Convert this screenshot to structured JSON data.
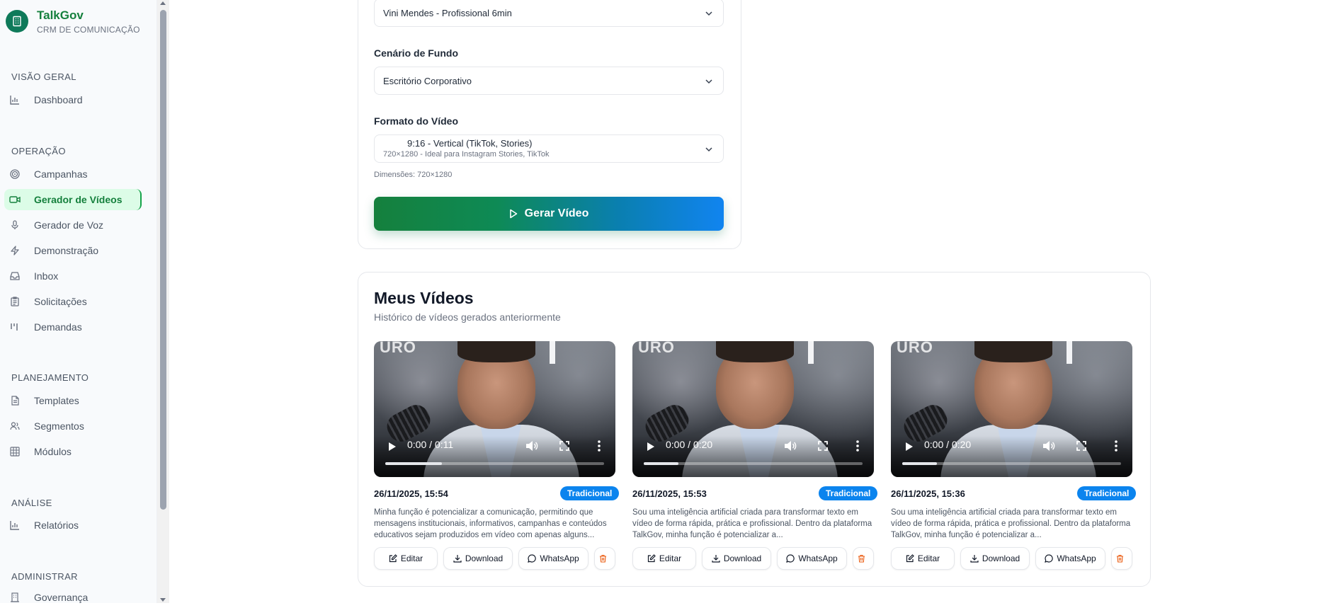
{
  "brand": {
    "title": "TalkGov",
    "subtitle": "CRM DE COMUNICAÇÃO",
    "logo_icon": "building-icon",
    "color": "#15803d"
  },
  "sidebar": {
    "sections": [
      {
        "title": "VISÃO GERAL",
        "items": [
          {
            "label": "Dashboard",
            "icon": "bar-chart-icon"
          }
        ]
      },
      {
        "title": "OPERAÇÃO",
        "items": [
          {
            "label": "Campanhas",
            "icon": "target-icon"
          },
          {
            "label": "Gerador de Vídeos",
            "icon": "video-icon",
            "active": true
          },
          {
            "label": "Gerador de Voz",
            "icon": "mic-icon"
          },
          {
            "label": "Demonstração",
            "icon": "zap-icon"
          },
          {
            "label": "Inbox",
            "icon": "inbox-icon"
          },
          {
            "label": "Solicitações",
            "icon": "clipboard-icon"
          },
          {
            "label": "Demandas",
            "icon": "kanban-icon"
          }
        ]
      },
      {
        "title": "PLANEJAMENTO",
        "items": [
          {
            "label": "Templates",
            "icon": "file-text-icon"
          },
          {
            "label": "Segmentos",
            "icon": "users-icon"
          },
          {
            "label": "Módulos",
            "icon": "grid-icon"
          }
        ]
      },
      {
        "title": "ANÁLISE",
        "items": [
          {
            "label": "Relatórios",
            "icon": "bar-chart-icon"
          }
        ]
      },
      {
        "title": "ADMINISTRAR",
        "items": [
          {
            "label": "Governança",
            "icon": "building-icon"
          }
        ]
      }
    ]
  },
  "form": {
    "avatar_value": "Vini Mendes - Profissional 6min",
    "background_label": "Cenário de Fundo",
    "background_value": "Escritório Corporativo",
    "format_label": "Formato do Vídeo",
    "format_value": "9:16 - Vertical (TikTok, Stories)",
    "format_detail": "720×1280 - Ideal para Instagram Stories, TikTok",
    "dimensions_hint": "Dimensões: 720×1280",
    "generate_label": "Gerar Vídeo"
  },
  "videos_section": {
    "title": "Meus Vídeos",
    "subtitle": "Histórico de vídeos gerados anteriormente",
    "buttons": {
      "edit": "Editar",
      "download": "Download",
      "whatsapp": "WhatsApp"
    },
    "badge_color": "#0b84ee",
    "videos": [
      {
        "time": "0:00 / 0:11",
        "progress": 0.26,
        "date": "26/11/2025, 15:54",
        "badge": "Tradicional",
        "overlay_text": "URO",
        "description": "Minha função é potencializar a comunicação, permitindo que mensagens institucionais, informativos, campanhas e conteúdos educativos sejam produzidos em vídeo com apenas alguns..."
      },
      {
        "time": "0:00 / 0:20",
        "progress": 0.16,
        "date": "26/11/2025, 15:53",
        "badge": "Tradicional",
        "overlay_text": "URO",
        "description": "Sou uma inteligência artificial criada para transformar texto em vídeo de forma rápida, prática e profissional. Dentro da plataforma TalkGov, minha função é potencializar a..."
      },
      {
        "time": "0:00 / 0:20",
        "progress": 0.16,
        "date": "26/11/2025, 15:36",
        "badge": "Tradicional",
        "overlay_text": "URO",
        "description": "Sou uma inteligência artificial criada para transformar texto em vídeo de forma rápida, prática e profissional. Dentro da plataforma TalkGov, minha função é potencializar a..."
      }
    ]
  }
}
